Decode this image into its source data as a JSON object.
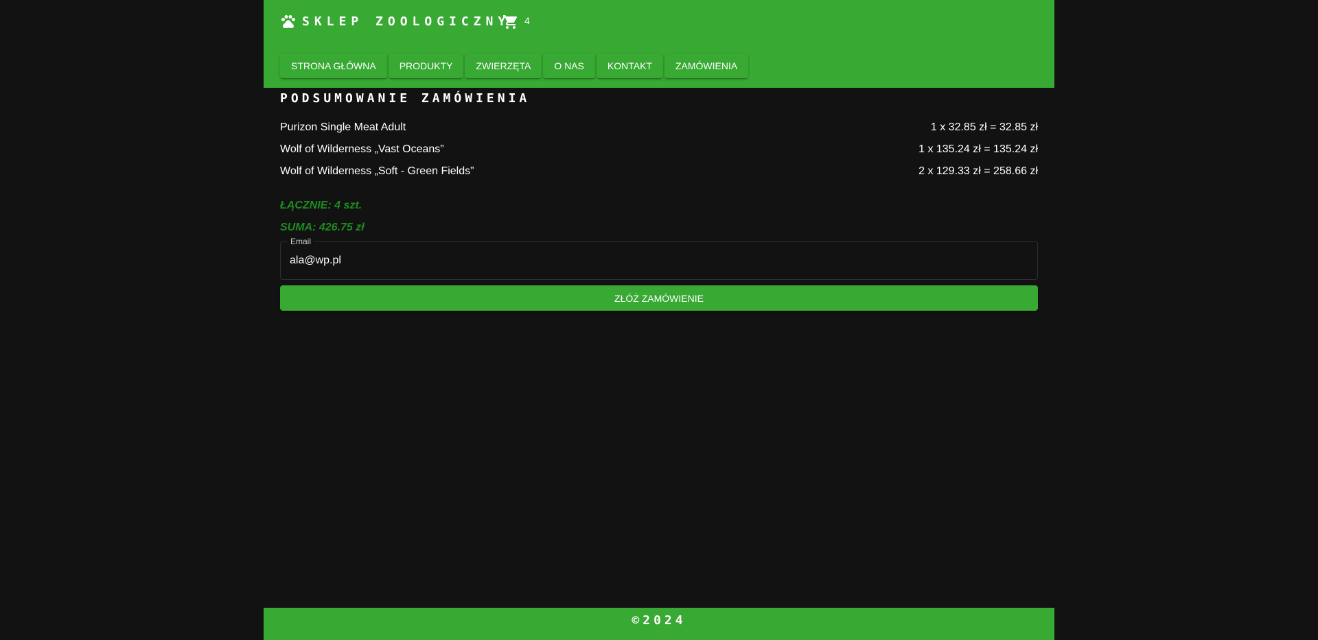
{
  "brand": {
    "title": "SKLEP ZOOLOGICZNY",
    "icon": "paw-icon"
  },
  "cart": {
    "icon": "cart-icon",
    "count": "4"
  },
  "nav": {
    "items": [
      {
        "label": "STRONA GŁÓWNA"
      },
      {
        "label": "PRODUKTY"
      },
      {
        "label": "ZWIERZĘTA"
      },
      {
        "label": "O NAS"
      },
      {
        "label": "KONTAKT"
      },
      {
        "label": "ZAMÓWIENIA"
      }
    ]
  },
  "summary": {
    "title": "PODSUMOWANIE ZAMÓWIENIA",
    "items": [
      {
        "name": "Purizon Single Meat Adult",
        "price": "1 x 32.85 zł = 32.85 zł"
      },
      {
        "name": "Wolf of Wilderness „Vast Oceans”",
        "price": "1 x 135.24 zł = 135.24 zł"
      },
      {
        "name": "Wolf of Wilderness „Soft - Green Fields”",
        "price": "2 x 129.33 zł = 258.66 zł"
      }
    ],
    "total_count": "ŁĄCZNIE: 4 szt.",
    "total_sum": "SUMA: 426.75 zł"
  },
  "form": {
    "email_label": "Email",
    "email_value": "ala@wp.pl",
    "submit_label": "ZŁÓŻ ZAMÓWIENIE"
  },
  "footer": {
    "text": "©2024"
  },
  "colors": {
    "accent": "#38a933",
    "background": "#121212",
    "totals_text": "#1e8c1e"
  }
}
